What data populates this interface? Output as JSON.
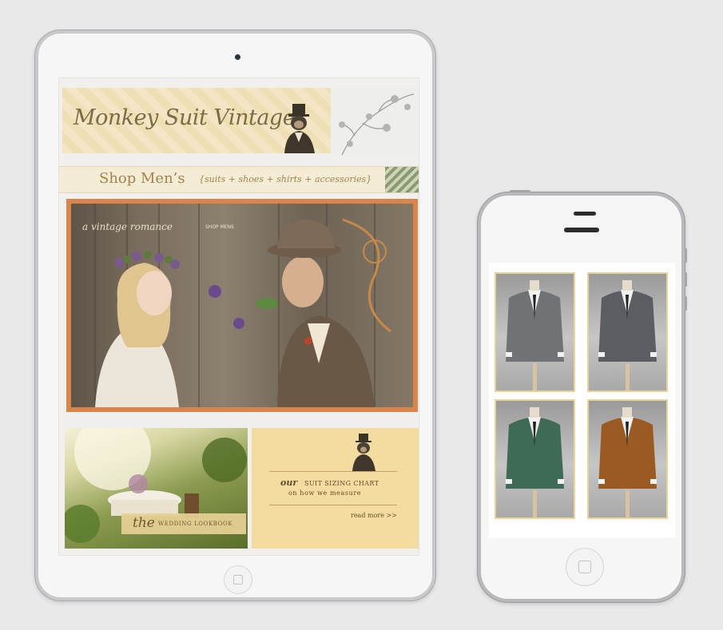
{
  "store": {
    "brand_title": "Monkey Suit Vintage",
    "shop_main": "Shop Men’s",
    "shop_sub": "{suits + shoes + shirts + accessories}",
    "hero_caption": "a vintage romance",
    "hero_link": "SHOP MENS",
    "lookbook_the": "the",
    "lookbook_label": "WEDDING LOOKBOOK",
    "sizing_our": "our",
    "sizing_chart": "SUIT SIZING CHART",
    "sizing_sub": "on how we measure",
    "sizing_more": "read more >>"
  },
  "phone": {
    "suits": [
      {
        "name": "grey double-breasted suit",
        "color": "#6f7376"
      },
      {
        "name": "charcoal pinstripe suit",
        "color": "#5a5d62"
      },
      {
        "name": "green three-piece suit",
        "color": "#3f6a55"
      },
      {
        "name": "rust corduroy three-piece suit",
        "color": "#9a5a22"
      }
    ]
  },
  "colors": {
    "background": "#e9e9ea",
    "accent_gold": "#a1834e",
    "hero_frame": "#d8864a",
    "tile_border": "#e8d49b"
  }
}
